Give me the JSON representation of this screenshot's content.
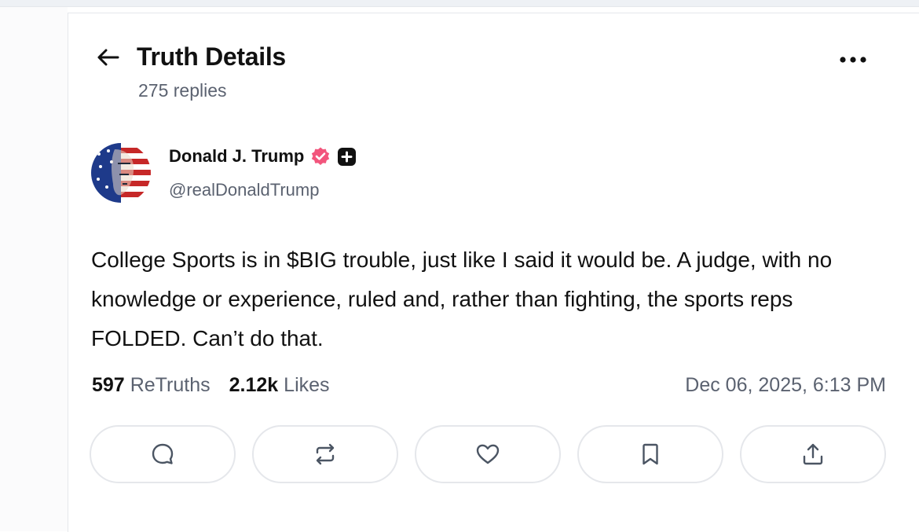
{
  "header": {
    "title": "Truth Details",
    "reply_count": "275 replies",
    "back_icon": "arrow-left-icon",
    "more_icon": "ellipsis-horizontal-icon"
  },
  "post": {
    "author": {
      "name": "Donald J. Trump",
      "handle": "@realDonaldTrump",
      "verified_badge_color": "#f2557c",
      "avatar_colors": [
        "#1e3a8a",
        "#c62828",
        "#ffffff"
      ]
    },
    "text": "College Sports is in $BIG trouble, just like I said it would be. A judge, with no knowledge or experience, ruled and, rather than fighting, the sports reps FOLDED. Can’t do that.",
    "stats": {
      "retruths_count": "597",
      "retruths_label": "ReTruths",
      "likes_count": "2.12k",
      "likes_label": "Likes"
    },
    "timestamp": "Dec 06, 2025, 6:13 PM"
  },
  "actions": [
    {
      "name": "reply-button",
      "icon": "comment-icon"
    },
    {
      "name": "retruth-button",
      "icon": "repost-icon"
    },
    {
      "name": "like-button",
      "icon": "heart-icon"
    },
    {
      "name": "bookmark-button",
      "icon": "bookmark-icon"
    },
    {
      "name": "share-button",
      "icon": "share-upload-icon"
    }
  ],
  "colors": {
    "text_primary": "#111111",
    "text_secondary": "#5b6270",
    "border": "#e5e7eb",
    "icon": "#4b5563"
  }
}
